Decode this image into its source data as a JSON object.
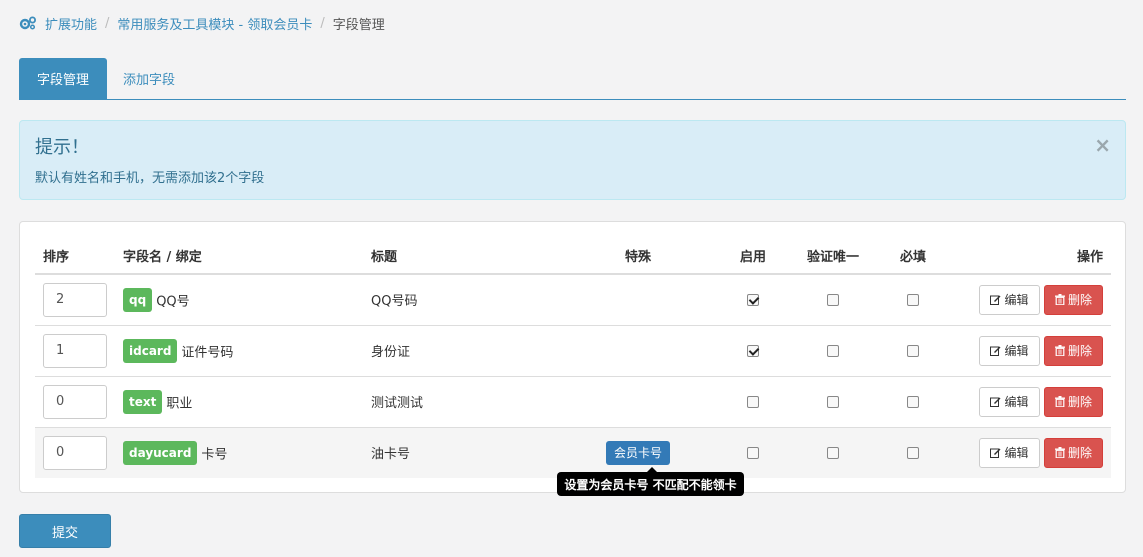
{
  "breadcrumb": {
    "items": [
      "扩展功能",
      "常用服务及工具模块 - 领取会员卡"
    ],
    "separator": "/",
    "current": "字段管理"
  },
  "tabs": [
    {
      "label": "字段管理",
      "active": true
    },
    {
      "label": "添加字段",
      "active": false
    }
  ],
  "alert": {
    "title": "提示！",
    "body": "默认有姓名和手机，无需添加该2个字段",
    "close": "×"
  },
  "table": {
    "headers": [
      "排序",
      "字段名 / 绑定",
      "标题",
      "特殊",
      "启用",
      "验证唯一",
      "必填",
      "操作"
    ],
    "rows": [
      {
        "order": "2",
        "key": "qq",
        "name": "QQ号",
        "title": "QQ号码",
        "special": "",
        "enabled": true,
        "unique": false,
        "required": false
      },
      {
        "order": "1",
        "key": "idcard",
        "name": "证件号码",
        "title": "身份证",
        "special": "",
        "enabled": true,
        "unique": false,
        "required": false
      },
      {
        "order": "0",
        "key": "text",
        "name": "职业",
        "title": "测试测试",
        "special": "",
        "enabled": false,
        "unique": false,
        "required": false
      },
      {
        "order": "0",
        "key": "dayucard",
        "name": "卡号",
        "title": "油卡号",
        "special": "会员卡号",
        "enabled": false,
        "unique": false,
        "required": false
      }
    ],
    "edit_label": "编辑",
    "delete_label": "删除"
  },
  "tooltip": "设置为会员卡号 不匹配不能领卡",
  "submit_label": "提交",
  "colors": {
    "primary": "#3c8dbc",
    "success": "#5cb85c",
    "danger": "#d9534f",
    "info_bg": "#d9edf7",
    "special_btn": "#337ab7"
  }
}
